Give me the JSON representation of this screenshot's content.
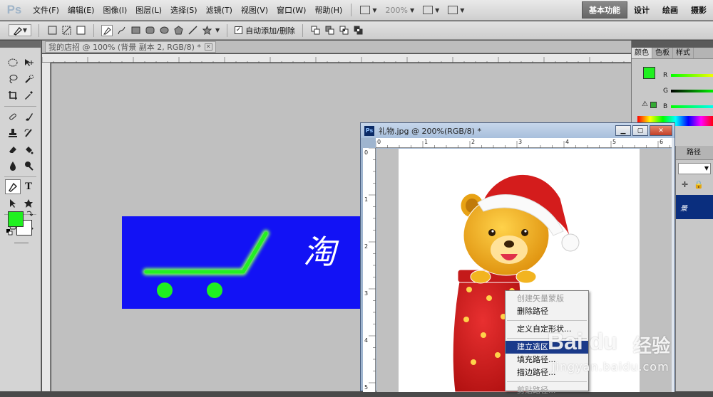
{
  "app": {
    "logo": "Ps"
  },
  "menu": {
    "items": [
      "文件(F)",
      "编辑(E)",
      "图像(I)",
      "图层(L)",
      "选择(S)",
      "滤镜(T)",
      "视图(V)",
      "窗口(W)",
      "帮助(H)"
    ],
    "zoom": "200%"
  },
  "workspaces": {
    "items": [
      "基本功能",
      "设计",
      "绘画",
      "摄影"
    ],
    "active": "基本功能"
  },
  "options": {
    "auto_add_delete_label": "自动添加/删除"
  },
  "doc1": {
    "tab_title": "我的店招 @ 100% (背景 副本 2, RGB/8) *",
    "banner_char": "淘"
  },
  "doc2": {
    "title": "礼物.jpg @ 200%(RGB/8) *",
    "ps_badge": "Ps"
  },
  "panels": {
    "tabs": [
      "颜色",
      "色板",
      "样式"
    ],
    "channels": [
      "R",
      "G",
      "B"
    ],
    "layer_tab": "路径",
    "layer_name_partial": "景"
  },
  "context_menu": {
    "items": [
      {
        "label": "创建矢量蒙版",
        "state": "disabled"
      },
      {
        "label": "删除路径",
        "state": "normal"
      },
      {
        "sep": true
      },
      {
        "label": "定义自定形状...",
        "state": "normal"
      },
      {
        "sep": true
      },
      {
        "label": "建立选区...",
        "state": "highlight"
      },
      {
        "label": "填充路径...",
        "state": "normal"
      },
      {
        "label": "描边路径...",
        "state": "normal"
      },
      {
        "sep": true
      },
      {
        "label": "剪贴路径...",
        "state": "disabled"
      }
    ]
  },
  "watermark": {
    "logo": "Bai du",
    "cn": "经验",
    "url": "jingyan.baidu.com"
  },
  "colors": {
    "foreground": "#20f020",
    "background": "#ffffff",
    "banner": "#1212f5",
    "accent": "#1a3a8a"
  }
}
